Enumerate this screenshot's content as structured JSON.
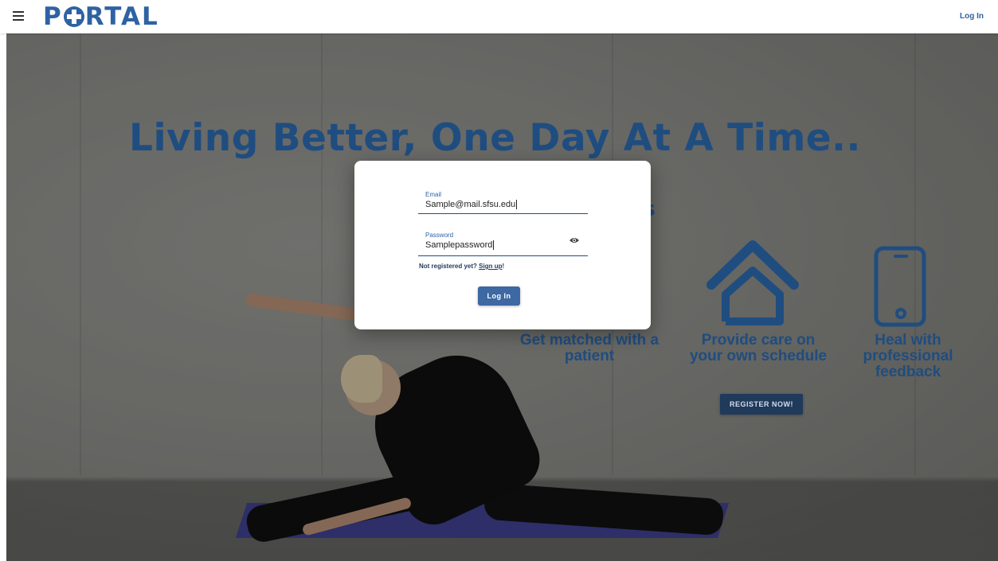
{
  "header": {
    "logo_text": "PORTAL",
    "login_label": "Log In"
  },
  "hero": {
    "title": "Living Better, One Day At A Time..",
    "subtitle_fragment": "ks",
    "features": [
      {
        "label": "Get matched with a patient",
        "icon": "stethoscope-icon"
      },
      {
        "label": "Provide care on your own schedule",
        "icon": "house-icon"
      },
      {
        "label": "Heal with professional feedback",
        "icon": "smartphone-icon"
      }
    ],
    "register_label": "REGISTER NOW!"
  },
  "login_modal": {
    "email_label": "Email",
    "email_value": "Sample@mail.sfsu.edu",
    "password_label": "Password",
    "password_value": "Samplepassword",
    "signup_prompt": "Not registered yet?",
    "signup_link": "Sign up",
    "signup_suffix": "!",
    "login_button": "Log In"
  },
  "colors": {
    "brand": "#2e63a3",
    "heading": "#1f4d80",
    "button": "#3d68a2",
    "register_button": "#1f3a5b"
  }
}
